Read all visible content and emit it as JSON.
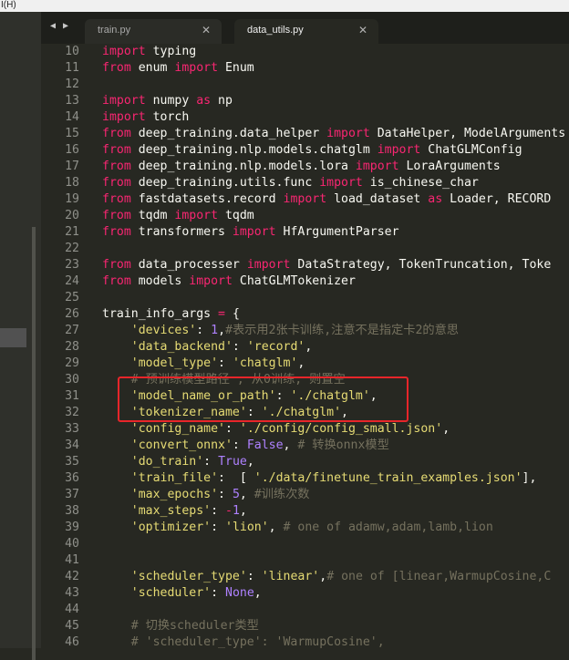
{
  "menu": {
    "label": "I(H)"
  },
  "tabs": [
    {
      "label": "train.py",
      "close": "✕",
      "active": false
    },
    {
      "label": "data_utils.py",
      "close": "✕",
      "active": true
    }
  ],
  "nav": {
    "back": "◀",
    "forward": "▶"
  },
  "colors": {
    "keyword": "#f92672",
    "string": "#e6db74",
    "number": "#ae81ff",
    "comment": "#75715e",
    "annotation_box": "#e8252a"
  },
  "lines": [
    {
      "n": "10",
      "tokens": [
        [
          "kw",
          "import"
        ],
        [
          "fn",
          " typing"
        ]
      ]
    },
    {
      "n": "11",
      "tokens": [
        [
          "kw",
          "from"
        ],
        [
          "fn",
          " enum "
        ],
        [
          "kw",
          "import"
        ],
        [
          "fn",
          " Enum"
        ]
      ]
    },
    {
      "n": "12",
      "tokens": []
    },
    {
      "n": "13",
      "tokens": [
        [
          "kw",
          "import"
        ],
        [
          "fn",
          " numpy "
        ],
        [
          "kw",
          "as"
        ],
        [
          "fn",
          " np"
        ]
      ]
    },
    {
      "n": "14",
      "tokens": [
        [
          "kw",
          "import"
        ],
        [
          "fn",
          " torch"
        ]
      ]
    },
    {
      "n": "15",
      "tokens": [
        [
          "kw",
          "from"
        ],
        [
          "fn",
          " deep_training.data_helper "
        ],
        [
          "kw",
          "import"
        ],
        [
          "fn",
          " DataHelper, ModelArguments"
        ]
      ]
    },
    {
      "n": "16",
      "tokens": [
        [
          "kw",
          "from"
        ],
        [
          "fn",
          " deep_training.nlp.models.chatglm "
        ],
        [
          "kw",
          "import"
        ],
        [
          "fn",
          " ChatGLMConfig"
        ]
      ]
    },
    {
      "n": "17",
      "tokens": [
        [
          "kw",
          "from"
        ],
        [
          "fn",
          " deep_training.nlp.models.lora "
        ],
        [
          "kw",
          "import"
        ],
        [
          "fn",
          " LoraArguments"
        ]
      ]
    },
    {
      "n": "18",
      "tokens": [
        [
          "kw",
          "from"
        ],
        [
          "fn",
          " deep_training.utils.func "
        ],
        [
          "kw",
          "import"
        ],
        [
          "fn",
          " is_chinese_char"
        ]
      ]
    },
    {
      "n": "19",
      "tokens": [
        [
          "kw",
          "from"
        ],
        [
          "fn",
          " fastdatasets.record "
        ],
        [
          "kw",
          "import"
        ],
        [
          "fn",
          " load_dataset "
        ],
        [
          "kw",
          "as"
        ],
        [
          "fn",
          " Loader, RECORD"
        ]
      ]
    },
    {
      "n": "20",
      "tokens": [
        [
          "kw",
          "from"
        ],
        [
          "fn",
          " tqdm "
        ],
        [
          "kw",
          "import"
        ],
        [
          "fn",
          " tqdm"
        ]
      ]
    },
    {
      "n": "21",
      "tokens": [
        [
          "kw",
          "from"
        ],
        [
          "fn",
          " transformers "
        ],
        [
          "kw",
          "import"
        ],
        [
          "fn",
          " HfArgumentParser"
        ]
      ]
    },
    {
      "n": "22",
      "tokens": []
    },
    {
      "n": "23",
      "tokens": [
        [
          "kw",
          "from"
        ],
        [
          "fn",
          " data_processer "
        ],
        [
          "kw",
          "import"
        ],
        [
          "fn",
          " DataStrategy, TokenTruncation, Toke"
        ]
      ]
    },
    {
      "n": "24",
      "tokens": [
        [
          "kw",
          "from"
        ],
        [
          "fn",
          " models "
        ],
        [
          "kw",
          "import"
        ],
        [
          "fn",
          " ChatGLMTokenizer"
        ]
      ]
    },
    {
      "n": "25",
      "tokens": []
    },
    {
      "n": "26",
      "tokens": [
        [
          "fn",
          "train_info_args "
        ],
        [
          "kw",
          "="
        ],
        [
          "fn",
          " {"
        ]
      ]
    },
    {
      "n": "27",
      "tokens": [
        [
          "fn",
          "    "
        ],
        [
          "str",
          "'devices'"
        ],
        [
          "fn",
          ": "
        ],
        [
          "num",
          "1"
        ],
        [
          "fn",
          ","
        ],
        [
          "cm",
          "#表示用2张卡训练,注意不是指定卡2的意思"
        ]
      ]
    },
    {
      "n": "28",
      "tokens": [
        [
          "fn",
          "    "
        ],
        [
          "str",
          "'data_backend'"
        ],
        [
          "fn",
          ": "
        ],
        [
          "str",
          "'record'"
        ],
        [
          "fn",
          ","
        ]
      ]
    },
    {
      "n": "29",
      "tokens": [
        [
          "fn",
          "    "
        ],
        [
          "str",
          "'model_type'"
        ],
        [
          "fn",
          ": "
        ],
        [
          "str",
          "'chatglm'"
        ],
        [
          "fn",
          ","
        ]
      ]
    },
    {
      "n": "30",
      "tokens": [
        [
          "fn",
          "    "
        ],
        [
          "cm",
          "# 预训练模型路径 , 从0训练, 则置空"
        ]
      ]
    },
    {
      "n": "31",
      "tokens": [
        [
          "fn",
          "    "
        ],
        [
          "str",
          "'model_name_or_path'"
        ],
        [
          "fn",
          ": "
        ],
        [
          "str",
          "'./chatglm'"
        ],
        [
          "fn",
          ","
        ]
      ]
    },
    {
      "n": "32",
      "tokens": [
        [
          "fn",
          "    "
        ],
        [
          "str",
          "'tokenizer_name'"
        ],
        [
          "fn",
          ": "
        ],
        [
          "str",
          "'./chatglm'"
        ],
        [
          "fn",
          ","
        ]
      ]
    },
    {
      "n": "33",
      "tokens": [
        [
          "fn",
          "    "
        ],
        [
          "str",
          "'config_name'"
        ],
        [
          "fn",
          ": "
        ],
        [
          "str",
          "'./config/config_small.json'"
        ],
        [
          "fn",
          ","
        ]
      ]
    },
    {
      "n": "34",
      "tokens": [
        [
          "fn",
          "    "
        ],
        [
          "str",
          "'convert_onnx'"
        ],
        [
          "fn",
          ": "
        ],
        [
          "num",
          "False"
        ],
        [
          "fn",
          ", "
        ],
        [
          "cm",
          "# 转换onnx模型"
        ]
      ]
    },
    {
      "n": "35",
      "tokens": [
        [
          "fn",
          "    "
        ],
        [
          "str",
          "'do_train'"
        ],
        [
          "fn",
          ": "
        ],
        [
          "num",
          "True"
        ],
        [
          "fn",
          ","
        ]
      ]
    },
    {
      "n": "36",
      "tokens": [
        [
          "fn",
          "    "
        ],
        [
          "str",
          "'train_file'"
        ],
        [
          "fn",
          ":  [ "
        ],
        [
          "str",
          "'./data/finetune_train_examples.json'"
        ],
        [
          "fn",
          "],"
        ]
      ]
    },
    {
      "n": "37",
      "tokens": [
        [
          "fn",
          "    "
        ],
        [
          "str",
          "'max_epochs'"
        ],
        [
          "fn",
          ": "
        ],
        [
          "num",
          "5"
        ],
        [
          "fn",
          ", "
        ],
        [
          "cm",
          "#训练次数"
        ]
      ]
    },
    {
      "n": "38",
      "tokens": [
        [
          "fn",
          "    "
        ],
        [
          "str",
          "'max_steps'"
        ],
        [
          "fn",
          ": "
        ],
        [
          "kw",
          "-"
        ],
        [
          "num",
          "1"
        ],
        [
          "fn",
          ","
        ]
      ]
    },
    {
      "n": "39",
      "tokens": [
        [
          "fn",
          "    "
        ],
        [
          "str",
          "'optimizer'"
        ],
        [
          "fn",
          ": "
        ],
        [
          "str",
          "'lion'"
        ],
        [
          "fn",
          ", "
        ],
        [
          "cm",
          "# one of adamw,adam,lamb,lion"
        ]
      ]
    },
    {
      "n": "40",
      "tokens": []
    },
    {
      "n": "41",
      "tokens": []
    },
    {
      "n": "42",
      "tokens": [
        [
          "fn",
          "    "
        ],
        [
          "str",
          "'scheduler_type'"
        ],
        [
          "fn",
          ": "
        ],
        [
          "str",
          "'linear'"
        ],
        [
          "fn",
          ","
        ],
        [
          "cm",
          "# one of [linear,WarmupCosine,C"
        ]
      ]
    },
    {
      "n": "43",
      "tokens": [
        [
          "fn",
          "    "
        ],
        [
          "str",
          "'scheduler'"
        ],
        [
          "fn",
          ": "
        ],
        [
          "num",
          "None"
        ],
        [
          "fn",
          ","
        ]
      ]
    },
    {
      "n": "44",
      "tokens": []
    },
    {
      "n": "45",
      "tokens": [
        [
          "fn",
          "    "
        ],
        [
          "cm",
          "# 切换scheduler类型"
        ]
      ]
    },
    {
      "n": "46",
      "tokens": [
        [
          "fn",
          "    "
        ],
        [
          "cm",
          "# 'scheduler_type': 'WarmupCosine',"
        ]
      ]
    }
  ]
}
